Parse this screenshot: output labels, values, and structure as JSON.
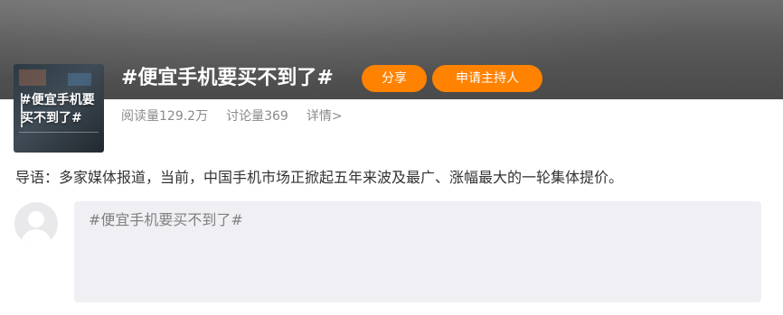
{
  "topic": {
    "title": "#便宜手机要买不到了#",
    "cover_text": "#便宜手机要\n买不到了#"
  },
  "actions": {
    "share_label": "分享",
    "apply_host_label": "申请主持人"
  },
  "stats": {
    "reads": "阅读量129.2万",
    "discussions": "讨论量369",
    "detail_link": "详情>"
  },
  "intro": {
    "text": "导语：多家媒体报道，当前，中国手机市场正掀起五年来波及最广、涨幅最大的一轮集体提价。"
  },
  "comment": {
    "placeholder": "#便宜手机要买不到了#"
  },
  "colors": {
    "accent": "#ff8200",
    "comment_bg": "#efeff4",
    "muted_text": "#8a8a8a"
  },
  "icons": {
    "avatar": "default-avatar-icon"
  }
}
